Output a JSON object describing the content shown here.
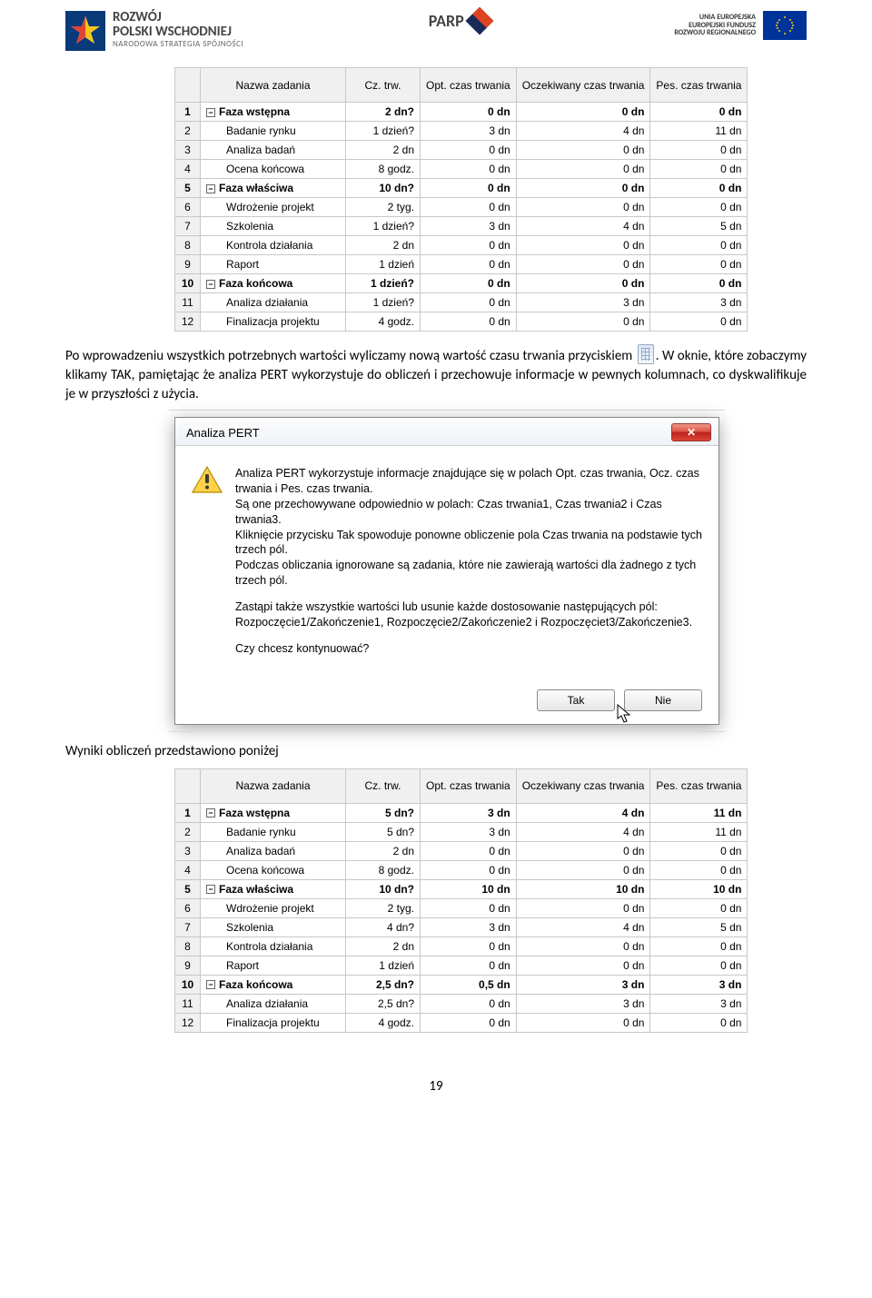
{
  "logos": {
    "left_line1": "ROZWÓJ",
    "left_line2": "POLSKI WSCHODNIEJ",
    "left_sub": "NARODOWA STRATEGIA SPÓJNOŚCI",
    "mid": "PARP",
    "right_line1": "UNIA EUROPEJSKA",
    "right_line2": "EUROPEJSKI FUNDUSZ",
    "right_line3": "ROZWOJU REGIONALNEGO"
  },
  "table_headers": [
    "Nazwa zadania",
    "Cz. trw.",
    "Opt. czas trwania",
    "Oczekiwany czas trwania",
    "Pes. czas trwania"
  ],
  "table1": [
    {
      "n": "1",
      "bold": true,
      "outline": "-",
      "name": "Faza wstępna",
      "d": "2 dn?",
      "o": "0 dn",
      "e": "0 dn",
      "p": "0 dn"
    },
    {
      "n": "2",
      "name": "Badanie rynku",
      "d": "1 dzień?",
      "o": "3 dn",
      "e": "4 dn",
      "p": "11 dn"
    },
    {
      "n": "3",
      "name": "Analiza badań",
      "d": "2 dn",
      "o": "0 dn",
      "e": "0 dn",
      "p": "0 dn"
    },
    {
      "n": "4",
      "name": "Ocena końcowa",
      "d": "8 godz.",
      "o": "0 dn",
      "e": "0 dn",
      "p": "0 dn"
    },
    {
      "n": "5",
      "bold": true,
      "outline": "-",
      "name": "Faza właściwa",
      "d": "10 dn?",
      "o": "0 dn",
      "e": "0 dn",
      "p": "0 dn"
    },
    {
      "n": "6",
      "name": "Wdrożenie projekt",
      "d": "2 tyg.",
      "o": "0 dn",
      "e": "0 dn",
      "p": "0 dn"
    },
    {
      "n": "7",
      "name": "Szkolenia",
      "d": "1 dzień?",
      "o": "3 dn",
      "e": "4 dn",
      "p": "5 dn"
    },
    {
      "n": "8",
      "name": "Kontrola działania",
      "d": "2 dn",
      "o": "0 dn",
      "e": "0 dn",
      "p": "0 dn"
    },
    {
      "n": "9",
      "name": "Raport",
      "d": "1 dzień",
      "o": "0 dn",
      "e": "0 dn",
      "p": "0 dn"
    },
    {
      "n": "10",
      "bold": true,
      "outline": "-",
      "name": "Faza końcowa",
      "d": "1 dzień?",
      "o": "0 dn",
      "e": "0 dn",
      "p": "0 dn"
    },
    {
      "n": "11",
      "name": "Analiza działania",
      "d": "1 dzień?",
      "o": "0 dn",
      "e": "3 dn",
      "p": "3 dn"
    },
    {
      "n": "12",
      "name": "Finalizacja projektu",
      "d": "4 godz.",
      "o": "0 dn",
      "e": "0 dn",
      "p": "0 dn"
    }
  ],
  "paragraph1a": "Po wprowadzeniu wszystkich potrzebnych wartości wyliczamy nową wartość czasu trwania przyciskiem ",
  "paragraph1b": ". W oknie, które zobaczymy klikamy TAK, pamiętając że analiza PERT wykorzystuje do obliczeń i przechowuje informacje w pewnych kolumnach, co dyskwalifikuje je w przyszłości z użycia.",
  "dialog": {
    "title": "Analiza PERT",
    "p1": "Analiza PERT wykorzystuje informacje znajdujące się w polach Opt. czas trwania, Ocz. czas trwania i Pes. czas trwania.",
    "p2": "Są one przechowywane odpowiednio w polach: Czas trwania1, Czas trwania2 i Czas trwania3.",
    "p3": "Kliknięcie przycisku Tak spowoduje ponowne obliczenie pola Czas trwania na podstawie tych trzech pól.",
    "p4": "Podczas obliczania ignorowane są zadania, które nie zawierają wartości dla żadnego z tych trzech pól.",
    "p5": "Zastąpi także wszystkie wartości lub usunie każde dostosowanie następujących pól: Rozpoczęcie1/Zakończenie1, Rozpoczęcie2/Zakończenie2 i Rozpoczęciet3/Zakończenie3.",
    "p6": "Czy chcesz kontynuować?",
    "yes": "Tak",
    "no": "Nie",
    "close": "✕"
  },
  "heading_below": "Wyniki obliczeń przedstawiono poniżej",
  "table2": [
    {
      "n": "1",
      "bold": true,
      "outline": "-",
      "name": "Faza wstępna",
      "d": "5 dn?",
      "o": "3 dn",
      "e": "4 dn",
      "p": "11 dn"
    },
    {
      "n": "2",
      "name": "Badanie rynku",
      "d": "5 dn?",
      "o": "3 dn",
      "e": "4 dn",
      "p": "11 dn"
    },
    {
      "n": "3",
      "name": "Analiza badań",
      "d": "2 dn",
      "o": "0 dn",
      "e": "0 dn",
      "p": "0 dn"
    },
    {
      "n": "4",
      "name": "Ocena końcowa",
      "d": "8 godz.",
      "o": "0 dn",
      "e": "0 dn",
      "p": "0 dn"
    },
    {
      "n": "5",
      "bold": true,
      "outline": "-",
      "name": "Faza właściwa",
      "d": "10 dn?",
      "o": "10 dn",
      "e": "10 dn",
      "p": "10 dn"
    },
    {
      "n": "6",
      "name": "Wdrożenie projekt",
      "d": "2 tyg.",
      "o": "0 dn",
      "e": "0 dn",
      "p": "0 dn"
    },
    {
      "n": "7",
      "name": "Szkolenia",
      "d": "4 dn?",
      "o": "3 dn",
      "e": "4 dn",
      "p": "5 dn"
    },
    {
      "n": "8",
      "name": "Kontrola działania",
      "d": "2 dn",
      "o": "0 dn",
      "e": "0 dn",
      "p": "0 dn"
    },
    {
      "n": "9",
      "name": "Raport",
      "d": "1 dzień",
      "o": "0 dn",
      "e": "0 dn",
      "p": "0 dn"
    },
    {
      "n": "10",
      "bold": true,
      "outline": "-",
      "name": "Faza końcowa",
      "d": "2,5 dn?",
      "o": "0,5 dn",
      "e": "3 dn",
      "p": "3 dn"
    },
    {
      "n": "11",
      "name": "Analiza działania",
      "d": "2,5 dn?",
      "o": "0 dn",
      "e": "3 dn",
      "p": "3 dn"
    },
    {
      "n": "12",
      "name": "Finalizacja projektu",
      "d": "4 godz.",
      "o": "0 dn",
      "e": "0 dn",
      "p": "0 dn"
    }
  ],
  "pagenum": "19"
}
